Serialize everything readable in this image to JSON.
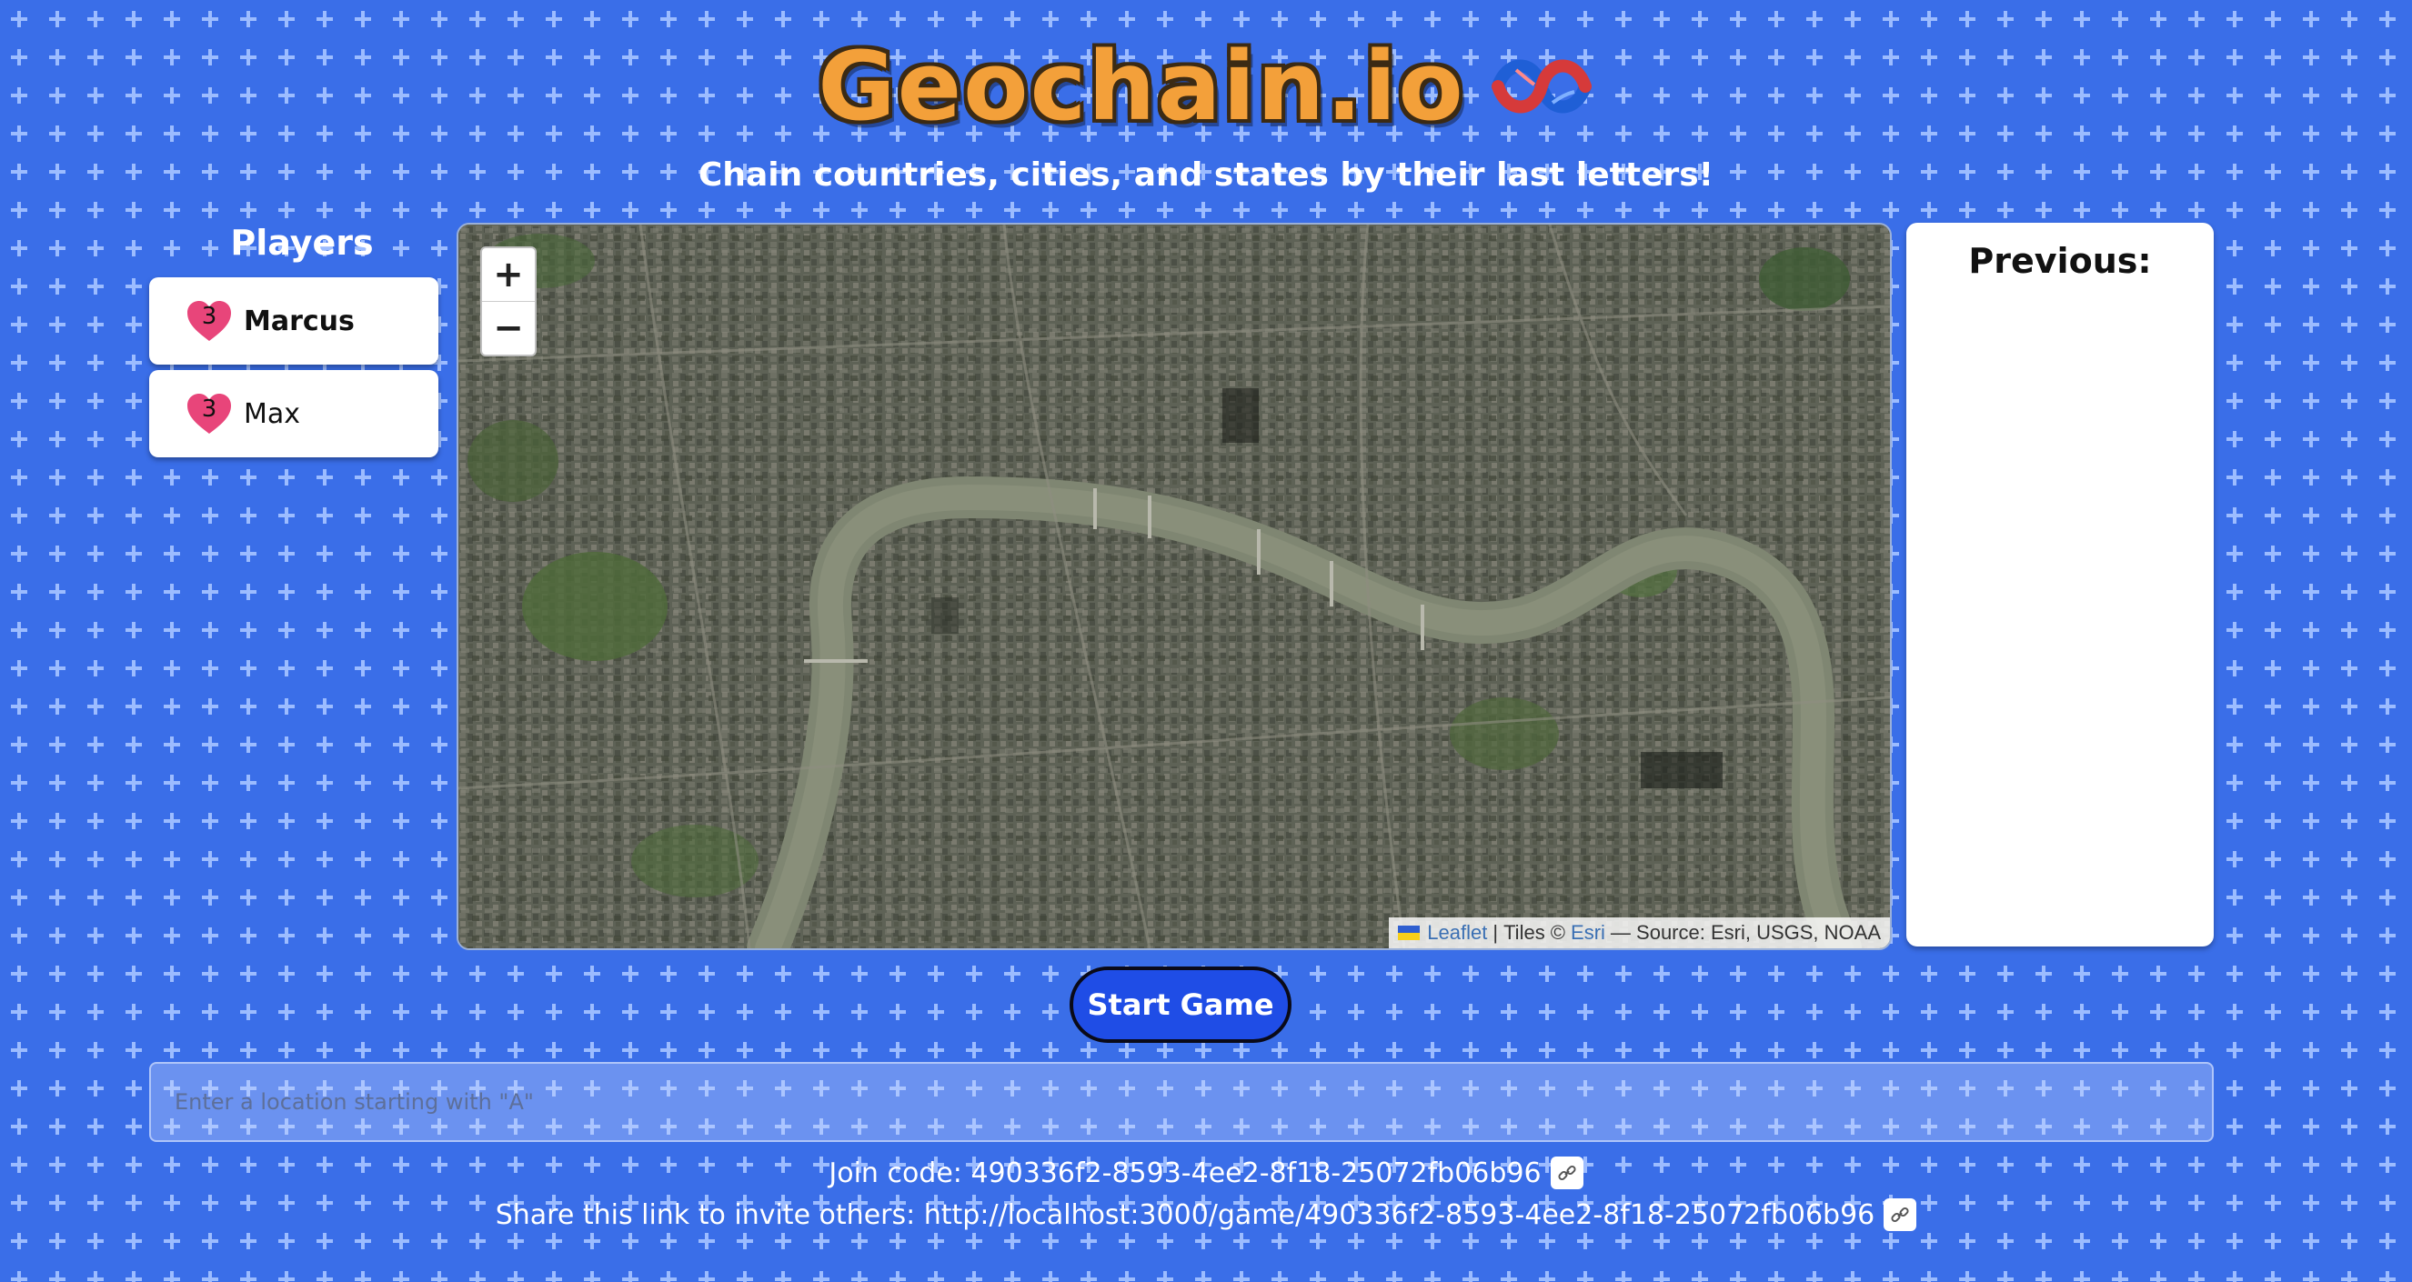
{
  "header": {
    "title": "Geochain.io",
    "logo_icon": "knot-icon",
    "subtitle": "Chain countries, cities, and states by their last letters!"
  },
  "players": {
    "heading": "Players",
    "list": [
      {
        "name": "Marcus",
        "lives": "3",
        "active": true
      },
      {
        "name": "Max",
        "lives": "3",
        "active": false
      }
    ]
  },
  "map": {
    "zoom_in": "+",
    "zoom_out": "−",
    "attribution": {
      "leaflet": "Leaflet",
      "separator": "|",
      "tiles": "Tiles ©",
      "esri": "Esri",
      "source": "— Source: Esri, USGS, NOAA"
    }
  },
  "previous": {
    "heading": "Previous:"
  },
  "controls": {
    "start_label": "Start Game",
    "input_placeholder": "Enter a location starting with \"A\""
  },
  "footer": {
    "join_label": "Join code: 490336f2-8593-4ee2-8f18-25072fb06b96",
    "share_label": "Share this link to invite others: http://localhost:3000/game/490336f2-8593-4ee2-8f18-25072fb06b96",
    "copy_icon": "link-icon"
  },
  "colors": {
    "background": "#3a6ee8",
    "title": "#f3a03a",
    "start_button": "#1f4de6",
    "heart": "#e8457a"
  }
}
